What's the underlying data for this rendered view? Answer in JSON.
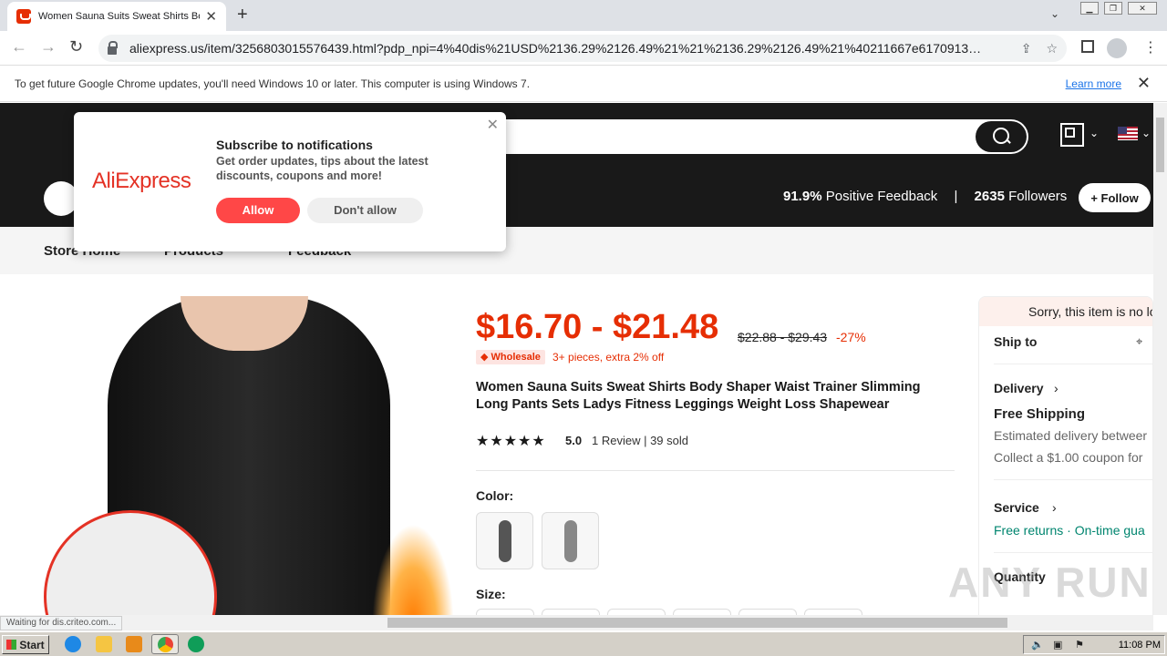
{
  "browser": {
    "tab_title": "Women Sauna Suits Sweat Shirts Bo",
    "url": "aliexpress.us/item/3256803015576439.html?pdp_npi=4%40dis%21USD%2136.29%2126.49%21%21%2136.29%2126.49%21%40211667e6170913…",
    "newtab": "+",
    "infobar_text": "To get future Google Chrome updates, you'll need Windows 10 or later. This computer is using Windows 7.",
    "infobar_link": "Learn more",
    "status": "Waiting for dis.criteo.com..."
  },
  "store": {
    "feedback_pct": "91.9%",
    "feedback_label": "Positive Feedback",
    "followers_count": "2635",
    "followers_label": "Followers",
    "follow_label": "+ Follow",
    "nav": [
      "Store Home",
      "Products",
      "Feedback"
    ]
  },
  "popup": {
    "logo": "AliExpress",
    "title": "Subscribe to notifications",
    "desc": "Get order updates, tips about the latest discounts, coupons and more!",
    "allow": "Allow",
    "deny": "Don't allow"
  },
  "product": {
    "price": "$16.70 - $21.48",
    "old_price": "$22.88 - $29.43",
    "discount": "-27%",
    "wholesale_badge": "Wholesale",
    "wholesale_note": "3+ pieces, extra 2% off",
    "title": "Women Sauna Suits Sweat Shirts Body Shaper Waist Trainer Slimming Long Pants Sets Ladys Fitness Leggings Weight Loss Shapewear",
    "stars": "★★★★★",
    "rating": "5.0",
    "reviews": "1 Review  |  39 sold",
    "color_label": "Color:",
    "size_label": "Size:"
  },
  "side": {
    "sorry": "Sorry, this item is no lo",
    "ship_to": "Ship to",
    "delivery": "Delivery",
    "free_shipping": "Free Shipping",
    "estimated": "Estimated delivery betweer",
    "coupon": "Collect a $1.00 coupon for",
    "service": "Service",
    "service_detail": "Free returns · On-time gua",
    "quantity": "Quantity"
  },
  "taskbar": {
    "start": "Start",
    "clock": "11:08 PM"
  },
  "watermark": "ANY RUN",
  "colors": {
    "accent": "#e62e04",
    "brand": "#e43225",
    "dark": "#191919"
  }
}
